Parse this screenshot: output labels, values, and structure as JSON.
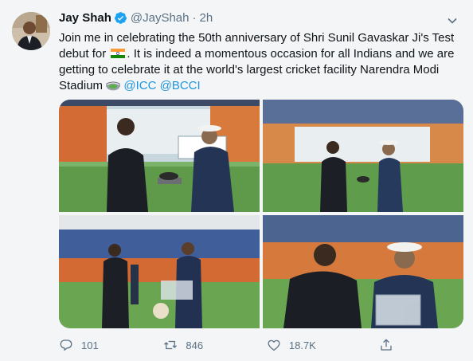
{
  "tweet": {
    "author_name": "Jay Shah",
    "handle": "@JayShah",
    "separator": "·",
    "time": "2h",
    "text_1": "Join me in celebrating the 50th anniversary of Shri Sunil Gavaskar Ji's Test debut for",
    "text_2": ". It is indeed a momentous occasion for all Indians and we are getting to celebrate it at the world's largest cricket facility Narendra Modi Stadium",
    "mention_1": "@ICC",
    "mention_2": "@BCCI",
    "flag_icon": "india-flag-icon",
    "emoji_icon": "stadium-icon"
  },
  "actions": {
    "reply_count": "101",
    "retweet_count": "846",
    "like_count": "18.7K"
  },
  "colors": {
    "background": "#f3f5f6",
    "accent": "#1b95e0",
    "muted": "#5b7083",
    "text": "#0f1419"
  }
}
